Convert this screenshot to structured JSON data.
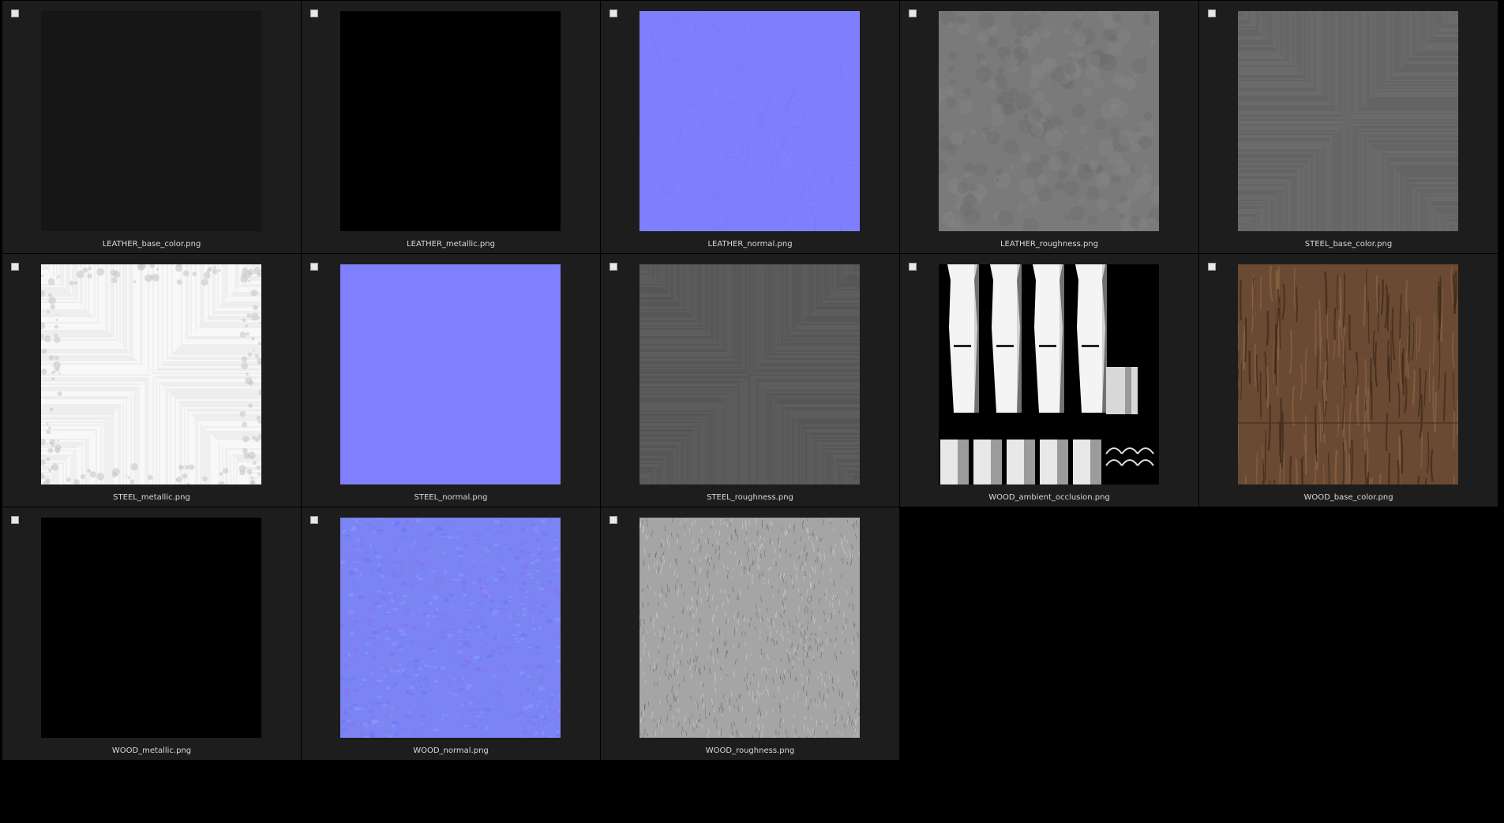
{
  "browser": {
    "items": [
      {
        "filename": "LEATHER_base_color.png",
        "swatch": "#161616",
        "texture": "flat"
      },
      {
        "filename": "LEATHER_metallic.png",
        "swatch": "#000000",
        "texture": "flat"
      },
      {
        "filename": "LEATHER_normal.png",
        "swatch": "#7f7ffe",
        "texture": "normal-fine"
      },
      {
        "filename": "LEATHER_roughness.png",
        "swatch": "#7a7a7a",
        "texture": "mottled-gray"
      },
      {
        "filename": "STEEL_base_color.png",
        "swatch": "#686868",
        "texture": "streak-gray"
      },
      {
        "filename": "STEEL_metallic.png",
        "swatch": "#f6f6f6",
        "texture": "streak-white"
      },
      {
        "filename": "STEEL_normal.png",
        "swatch": "#8080ff",
        "texture": "flat"
      },
      {
        "filename": "STEEL_roughness.png",
        "swatch": "#5a5a5a",
        "texture": "streak-dark"
      },
      {
        "filename": "WOOD_ambient_occlusion.png",
        "swatch": "#000000",
        "texture": "ao"
      },
      {
        "filename": "WOOD_base_color.png",
        "swatch": "#6a4a32",
        "texture": "wood"
      },
      {
        "filename": "WOOD_metallic.png",
        "swatch": "#000000",
        "texture": "flat"
      },
      {
        "filename": "WOOD_normal.png",
        "swatch": "#7c83f2",
        "texture": "normal-noisy"
      },
      {
        "filename": "WOOD_roughness.png",
        "swatch": "#a5a5a5",
        "texture": "rough-gray"
      }
    ]
  },
  "colors": {
    "background": "#000000",
    "tile": "#1d1d1d",
    "label": "#d9d9d9",
    "checkbox": "#e8e8e8"
  }
}
